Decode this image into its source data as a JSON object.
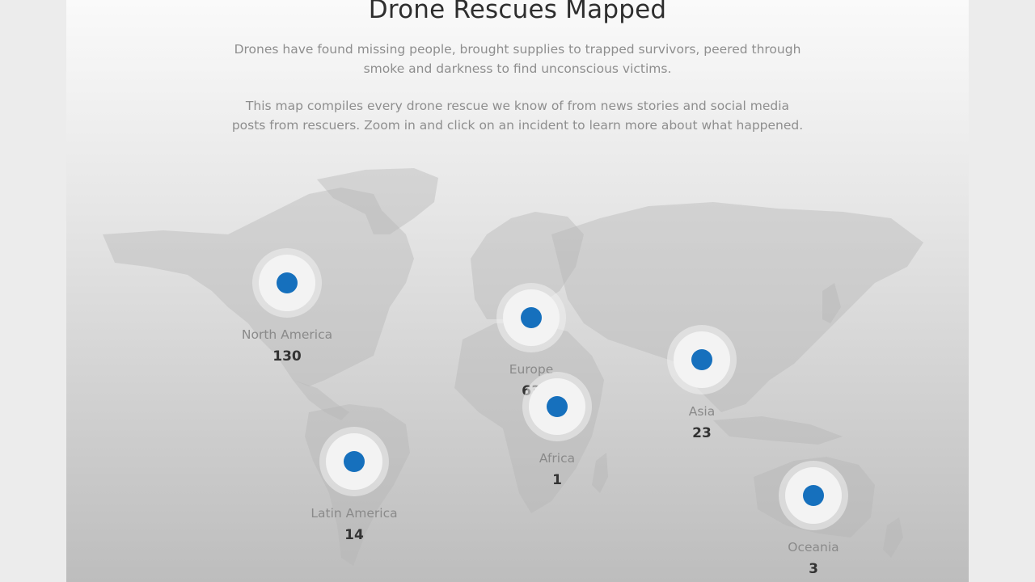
{
  "header": {
    "title": "Drone Rescues Mapped",
    "intro_1": "Drones have found missing people, brought supplies to trapped survivors, peered through smoke and darkness to find unconscious victims.",
    "intro_2": "This map compiles every drone rescue we know of from news stories and social media posts from rescuers. Zoom in and click on an incident to learn more about what happened."
  },
  "colors": {
    "marker_dot": "#1670bd",
    "page_background": "#ececec",
    "title_text": "#2e2e2e",
    "body_text": "#8e8e8e"
  },
  "regions": [
    {
      "id": "north-america",
      "label": "North America",
      "count": "130"
    },
    {
      "id": "europe",
      "label": "Europe",
      "count": "63"
    },
    {
      "id": "asia",
      "label": "Asia",
      "count": "23"
    },
    {
      "id": "africa",
      "label": "Africa",
      "count": "1"
    },
    {
      "id": "latin-america",
      "label": "Latin America",
      "count": "14"
    },
    {
      "id": "oceania",
      "label": "Oceania",
      "count": "3"
    }
  ]
}
